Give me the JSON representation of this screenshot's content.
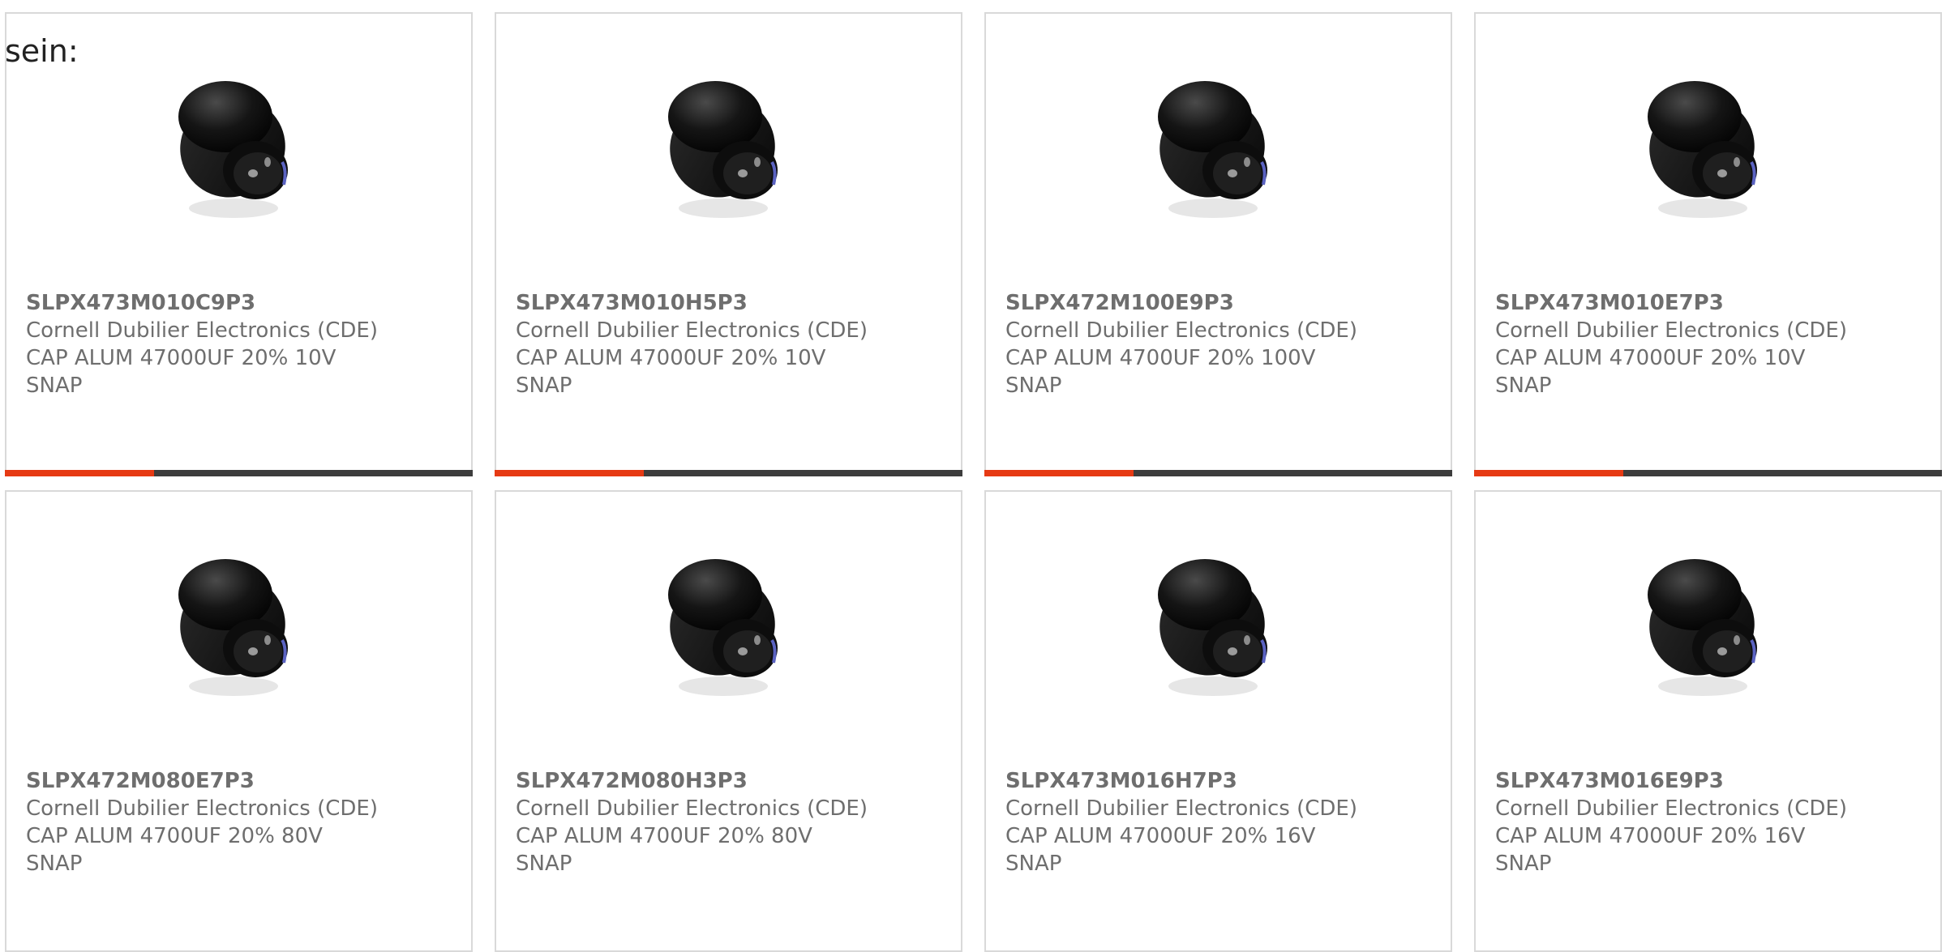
{
  "intro_text": "sein:",
  "products": [
    {
      "part": "SLPX473M010C9P3",
      "manufacturer": "Cornell Dubilier Electronics (CDE)",
      "desc": "CAP ALUM 47000UF 20% 10V",
      "desc2": "SNAP"
    },
    {
      "part": "SLPX473M010H5P3",
      "manufacturer": "Cornell Dubilier Electronics (CDE)",
      "desc": "CAP ALUM 47000UF 20% 10V",
      "desc2": "SNAP"
    },
    {
      "part": "SLPX472M100E9P3",
      "manufacturer": "Cornell Dubilier Electronics (CDE)",
      "desc": "CAP ALUM 4700UF 20% 100V",
      "desc2": "SNAP"
    },
    {
      "part": "SLPX473M010E7P3",
      "manufacturer": "Cornell Dubilier Electronics (CDE)",
      "desc": "CAP ALUM 47000UF 20% 10V",
      "desc2": "SNAP"
    },
    {
      "part": "SLPX472M080E7P3",
      "manufacturer": "Cornell Dubilier Electronics (CDE)",
      "desc": "CAP ALUM 4700UF 20% 80V",
      "desc2": "SNAP"
    },
    {
      "part": "SLPX472M080H3P3",
      "manufacturer": "Cornell Dubilier Electronics (CDE)",
      "desc": "CAP ALUM 4700UF 20% 80V",
      "desc2": "SNAP"
    },
    {
      "part": "SLPX473M016H7P3",
      "manufacturer": "Cornell Dubilier Electronics (CDE)",
      "desc": "CAP ALUM 47000UF 20% 16V",
      "desc2": "SNAP"
    },
    {
      "part": "SLPX473M016E9P3",
      "manufacturer": "Cornell Dubilier Electronics (CDE)",
      "desc": "CAP ALUM 47000UF 20% 16V",
      "desc2": "SNAP"
    }
  ],
  "colors": {
    "accent": "#e63a14",
    "bar": "#3d3d3d",
    "text": "#6e6e6e",
    "border": "#d9d9d9"
  },
  "icons": {
    "product_image": "capacitor-image"
  }
}
